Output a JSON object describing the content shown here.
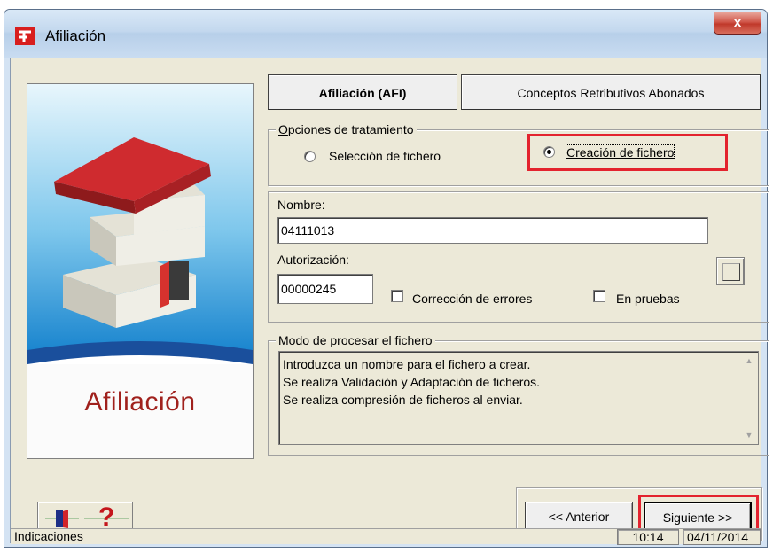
{
  "window": {
    "title": "Afiliación",
    "close_glyph": "x"
  },
  "side_panel": {
    "caption": "Afiliación"
  },
  "tabs": [
    {
      "label": "Afiliación (AFI)",
      "active": true
    },
    {
      "label": "Conceptos Retributivos Abonados",
      "active": false
    }
  ],
  "opciones": {
    "legend": "Opciones de tratamiento",
    "options": [
      {
        "label": "Selección de fichero",
        "checked": false
      },
      {
        "label": "Creación de fichero",
        "checked": true
      }
    ]
  },
  "form": {
    "nombre_label": "Nombre:",
    "nombre_value": "04111013",
    "autorizacion_label": "Autorización:",
    "autorizacion_value": "00000245",
    "correccion_label": "Corrección de errores",
    "pruebas_label": "En pruebas"
  },
  "modo": {
    "legend": "Modo de procesar el fichero",
    "lines": [
      "Introduzca un nombre para el fichero a crear.",
      "Se realiza Validación y Adaptación de ficheros.",
      "Se realiza compresión de ficheros al enviar."
    ]
  },
  "nav": {
    "anterior": "<< Anterior",
    "siguiente": "Siguiente >>"
  },
  "help": {
    "question": "?"
  },
  "status": {
    "text": "Indicaciones",
    "time": "10:14",
    "date": "04/11/2014"
  },
  "icons": [
    "app-logo-icon",
    "close-icon",
    "house-icon",
    "browse-icon",
    "exit-door-icon",
    "help-question-icon"
  ],
  "colors": {
    "highlight": "#e3232e",
    "caption": "#a0211d",
    "roof": "#c8282d"
  }
}
